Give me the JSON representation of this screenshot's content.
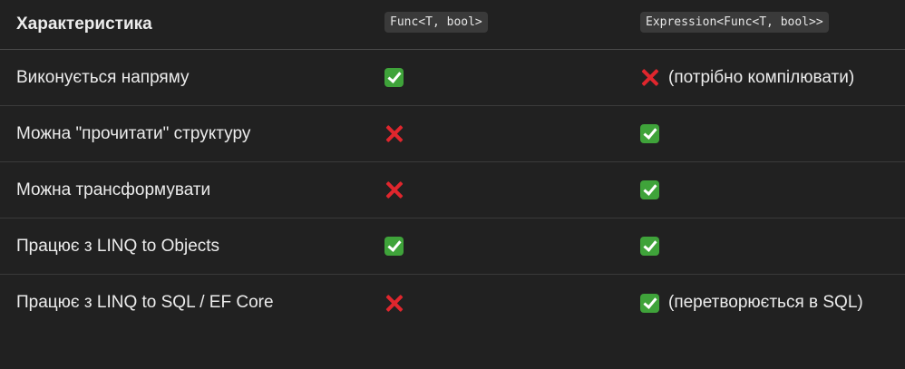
{
  "header": {
    "col1": "Характеристика",
    "col2": "Func<T, bool>",
    "col3": "Expression<Func<T, bool>>"
  },
  "rows": [
    {
      "label": "Виконується напряму",
      "func": {
        "icon": "check-icon",
        "note": ""
      },
      "expr": {
        "icon": "cross-icon",
        "note": "(потрібно компілювати)"
      }
    },
    {
      "label": "Можна \"прочитати\" структуру",
      "func": {
        "icon": "cross-icon",
        "note": ""
      },
      "expr": {
        "icon": "check-icon",
        "note": ""
      }
    },
    {
      "label": "Можна трансформувати",
      "func": {
        "icon": "cross-icon",
        "note": ""
      },
      "expr": {
        "icon": "check-icon",
        "note": ""
      }
    },
    {
      "label": "Працює з LINQ to Objects",
      "func": {
        "icon": "check-icon",
        "note": ""
      },
      "expr": {
        "icon": "check-icon",
        "note": ""
      }
    },
    {
      "label": "Працює з LINQ to SQL / EF Core",
      "func": {
        "icon": "cross-icon",
        "note": ""
      },
      "expr": {
        "icon": "check-icon",
        "note": "(перетворюється в SQL)"
      }
    }
  ],
  "colors": {
    "background": "#212121",
    "text": "#ececec",
    "check": "#3fa33a",
    "cross": "#e0262d",
    "code_bg": "#3a3a3a"
  }
}
